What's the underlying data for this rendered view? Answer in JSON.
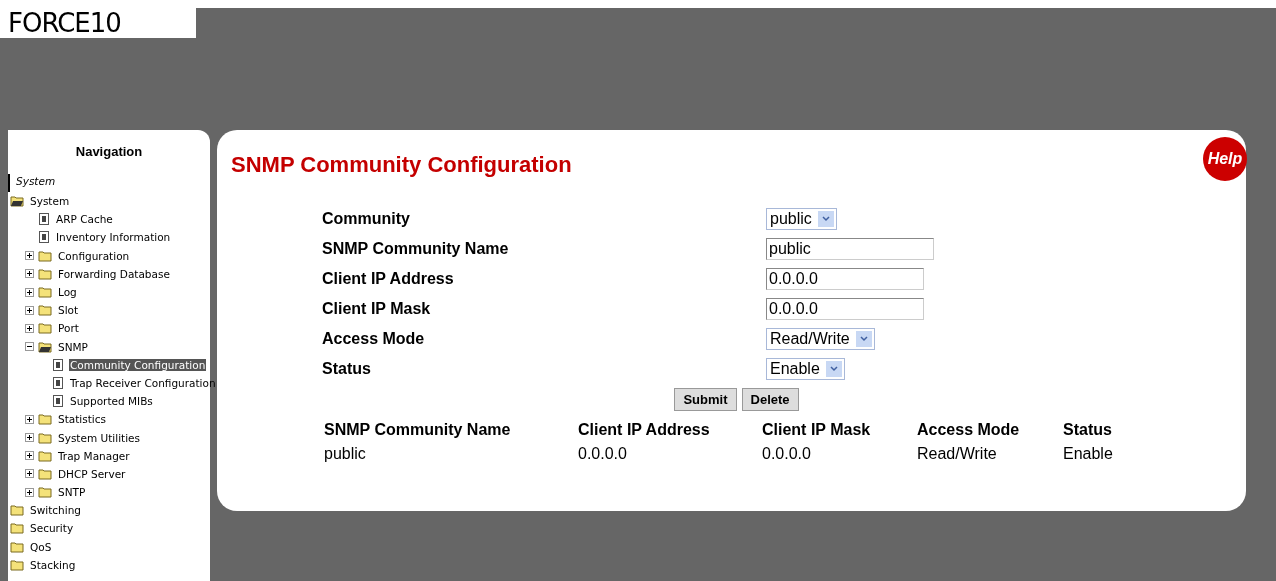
{
  "logo": {
    "text": "FORCE10"
  },
  "navigation": {
    "title": "Navigation",
    "heading": "System",
    "tree": [
      {
        "label": "System",
        "kind": "folder",
        "expanded": true,
        "selected": false,
        "children": [
          {
            "label": "ARP Cache",
            "kind": "page",
            "selected": false
          },
          {
            "label": "Inventory Information",
            "kind": "page",
            "selected": false
          },
          {
            "label": "Configuration",
            "kind": "folder",
            "expanded": false,
            "selected": false
          },
          {
            "label": "Forwarding Database",
            "kind": "folder",
            "expanded": false,
            "selected": false
          },
          {
            "label": "Log",
            "kind": "folder",
            "expanded": false,
            "selected": false
          },
          {
            "label": "Slot",
            "kind": "folder",
            "expanded": false,
            "selected": false
          },
          {
            "label": "Port",
            "kind": "folder",
            "expanded": false,
            "selected": false
          },
          {
            "label": "SNMP",
            "kind": "folder",
            "expanded": true,
            "selected": false,
            "children": [
              {
                "label": "Community Configuration",
                "kind": "page",
                "selected": true
              },
              {
                "label": "Trap Receiver Configuration",
                "kind": "page",
                "selected": false
              },
              {
                "label": "Supported MIBs",
                "kind": "page",
                "selected": false
              }
            ]
          },
          {
            "label": "Statistics",
            "kind": "folder",
            "expanded": false,
            "selected": false
          },
          {
            "label": "System Utilities",
            "kind": "folder",
            "expanded": false,
            "selected": false
          },
          {
            "label": "Trap Manager",
            "kind": "folder",
            "expanded": false,
            "selected": false
          },
          {
            "label": "DHCP Server",
            "kind": "folder",
            "expanded": false,
            "selected": false
          },
          {
            "label": "SNTP",
            "kind": "folder",
            "expanded": false,
            "selected": false
          }
        ]
      },
      {
        "label": "Switching",
        "kind": "root",
        "selected": false
      },
      {
        "label": "Security",
        "kind": "root",
        "selected": false
      },
      {
        "label": "QoS",
        "kind": "root",
        "selected": false
      },
      {
        "label": "Stacking",
        "kind": "root",
        "selected": false
      }
    ]
  },
  "page": {
    "title": "SNMP Community Configuration",
    "help": "Help",
    "fields": [
      {
        "label": "Community",
        "kind": "select",
        "value": "public"
      },
      {
        "label": "SNMP Community Name",
        "kind": "text",
        "value": "public"
      },
      {
        "label": "Client IP Address",
        "kind": "text",
        "value": "0.0.0.0"
      },
      {
        "label": "Client IP Mask",
        "kind": "text",
        "value": "0.0.0.0"
      },
      {
        "label": "Access Mode",
        "kind": "select",
        "value": "Read/Write"
      },
      {
        "label": "Status",
        "kind": "select",
        "value": "Enable"
      }
    ],
    "buttons": [
      "Submit",
      "Delete"
    ],
    "table": {
      "columns": [
        "SNMP Community Name",
        "Client IP Address",
        "Client IP Mask",
        "Access Mode",
        "Status"
      ],
      "rows": [
        [
          "public",
          "0.0.0.0",
          "0.0.0.0",
          "Read/Write",
          "Enable"
        ]
      ]
    }
  }
}
